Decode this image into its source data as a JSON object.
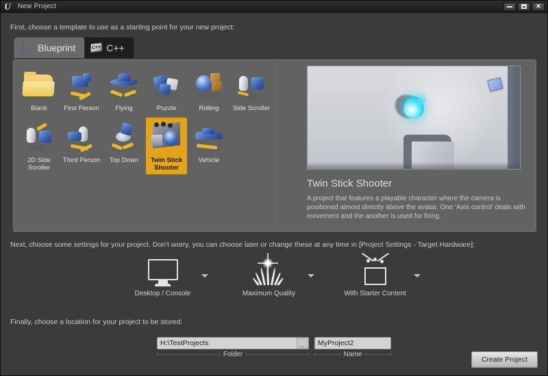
{
  "window": {
    "title": "New Project",
    "logo_icon": "unreal-engine-logo",
    "minimize_label": "",
    "maximize_label": "",
    "close_label": "✕"
  },
  "instructions": {
    "step1": "First, choose a template to use as a starting point for your new project:",
    "step2": "Next, choose some settings for your project. Don't worry, you can choose later or change these at any time in [Project Settings - Target Hardware]:",
    "step3": "Finally, choose a location for your project to be stored:"
  },
  "tabs": [
    {
      "label": "Blueprint",
      "icon": "blueprint-book-icon",
      "active": true
    },
    {
      "label": "C++",
      "icon": "cpp-card-icon",
      "active": false,
      "badge": "C++"
    }
  ],
  "templates": [
    {
      "label": "Blank",
      "icon": "blank-folder-icon",
      "selected": false
    },
    {
      "label": "First\nPerson",
      "icon": "first-person-icon",
      "selected": false
    },
    {
      "label": "Flying",
      "icon": "flying-ufo-icon",
      "selected": false
    },
    {
      "label": "Puzzle",
      "icon": "puzzle-pieces-icon",
      "selected": false
    },
    {
      "label": "Rolling",
      "icon": "rolling-ball-icon",
      "selected": false
    },
    {
      "label": "Side\nScroller",
      "icon": "side-scroller-icon",
      "selected": false
    },
    {
      "label": "2D Side\nScroller",
      "icon": "2d-side-scroller-icon",
      "selected": false
    },
    {
      "label": "Third\nPerson",
      "icon": "third-person-icon",
      "selected": false
    },
    {
      "label": "Top Down",
      "icon": "top-down-icon",
      "selected": false
    },
    {
      "label": "Twin Stick\nShooter",
      "icon": "twin-stick-shooter-icon",
      "selected": true
    },
    {
      "label": "Vehicle",
      "icon": "vehicle-car-icon",
      "selected": false
    }
  ],
  "preview": {
    "title": "Twin Stick Shooter",
    "description": "A project that features a playable character where the camera is positioned almost directly above the avatar. One 'Axis control' deals with movement and the another is used for firing.",
    "image_alt": "top-down-scene-preview"
  },
  "settings": [
    {
      "label": "Desktop / Console",
      "icon": "monitor-icon",
      "caret": "chevron-down-icon"
    },
    {
      "label": "Maximum Quality",
      "icon": "grass-sun-icon",
      "caret": "chevron-down-icon"
    },
    {
      "label": "With Starter Content",
      "icon": "starter-content-box-icon",
      "caret": "chevron-down-icon"
    }
  ],
  "location": {
    "folder": {
      "caption": "Folder",
      "value": "H:\\TestProjects",
      "placeholder": "",
      "browse_label": "..."
    },
    "name": {
      "caption": "Name",
      "value": "MyProject2",
      "placeholder": ""
    }
  },
  "actions": {
    "create_project": "Create Project"
  },
  "colors": {
    "window_bg": "#3b3b3b",
    "panel_bg": "#626262",
    "selected_tile": "#e3a41a",
    "tab_active": "#6a6a6a",
    "tab_inactive": "#1e1e1e",
    "text": "#cdcdcd"
  }
}
